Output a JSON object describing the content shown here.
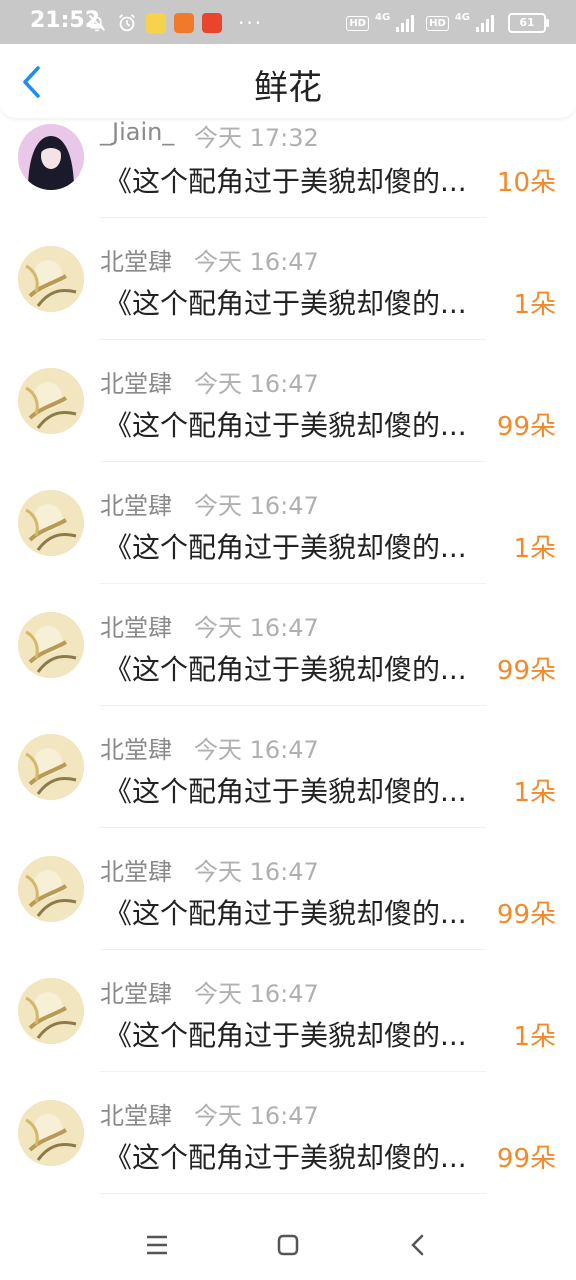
{
  "status_bar": {
    "time": "21:52",
    "left_icons": [
      "bell-off-icon",
      "alarm-icon",
      "app-icon-1",
      "app-icon-2",
      "app-icon-3"
    ],
    "more": "···",
    "hd1": "HD",
    "net1": "4G",
    "hd2": "HD",
    "net2": "4G",
    "battery": "61"
  },
  "header": {
    "title": "鲜花",
    "back_icon": "chevron-left-icon"
  },
  "accent_color": "#f28a2a",
  "items": [
    {
      "name": "_Jiain_",
      "time": "今天 17:32",
      "text": "《这个配角过于美貌却傻的...",
      "amount": "10朵"
    },
    {
      "name": "北堂肆",
      "time": "今天 16:47",
      "text": "《这个配角过于美貌却傻的...",
      "amount": "1朵"
    },
    {
      "name": "北堂肆",
      "time": "今天 16:47",
      "text": "《这个配角过于美貌却傻的...",
      "amount": "99朵"
    },
    {
      "name": "北堂肆",
      "time": "今天 16:47",
      "text": "《这个配角过于美貌却傻的...",
      "amount": "1朵"
    },
    {
      "name": "北堂肆",
      "time": "今天 16:47",
      "text": "《这个配角过于美貌却傻的...",
      "amount": "99朵"
    },
    {
      "name": "北堂肆",
      "time": "今天 16:47",
      "text": "《这个配角过于美貌却傻的...",
      "amount": "1朵"
    },
    {
      "name": "北堂肆",
      "time": "今天 16:47",
      "text": "《这个配角过于美貌却傻的...",
      "amount": "99朵"
    },
    {
      "name": "北堂肆",
      "time": "今天 16:47",
      "text": "《这个配角过于美貌却傻的...",
      "amount": "1朵"
    },
    {
      "name": "北堂肆",
      "time": "今天 16:47",
      "text": "《这个配角过于美貌却傻的...",
      "amount": "99朵"
    }
  ],
  "nav_bar": [
    "menu-icon",
    "home-icon",
    "back-icon"
  ]
}
